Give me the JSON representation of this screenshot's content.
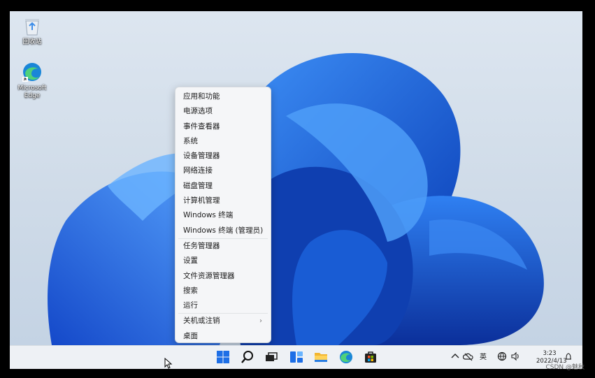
{
  "desktop": {
    "icons": [
      {
        "label": "回收站",
        "icon": "recycle-bin-icon"
      },
      {
        "label": "Microsoft Edge",
        "icon": "edge-icon"
      }
    ]
  },
  "context_menu": {
    "items": [
      "应用和功能",
      "电源选项",
      "事件查看器",
      "系统",
      "设备管理器",
      "网络连接",
      "磁盘管理",
      "计算机管理",
      "Windows 终端",
      "Windows 终端 (管理员)",
      "任务管理器",
      "设置",
      "文件资源管理器",
      "搜索",
      "运行",
      "关机或注销",
      "桌面"
    ],
    "submenu_arrow": "›"
  },
  "taskbar": {
    "apps": [
      "start-icon",
      "search-icon",
      "task-view-icon",
      "widgets-icon",
      "file-explorer-icon",
      "edge-icon",
      "store-icon"
    ],
    "tray": {
      "input_method": "英",
      "time": "3:23",
      "date": "2022/4/13"
    }
  },
  "watermark": "CSDN @魅秋",
  "colors": {
    "accent": "#1e6fe6",
    "menu_bg": "#f5f6f8",
    "taskbar_bg": "#eef1f5"
  }
}
